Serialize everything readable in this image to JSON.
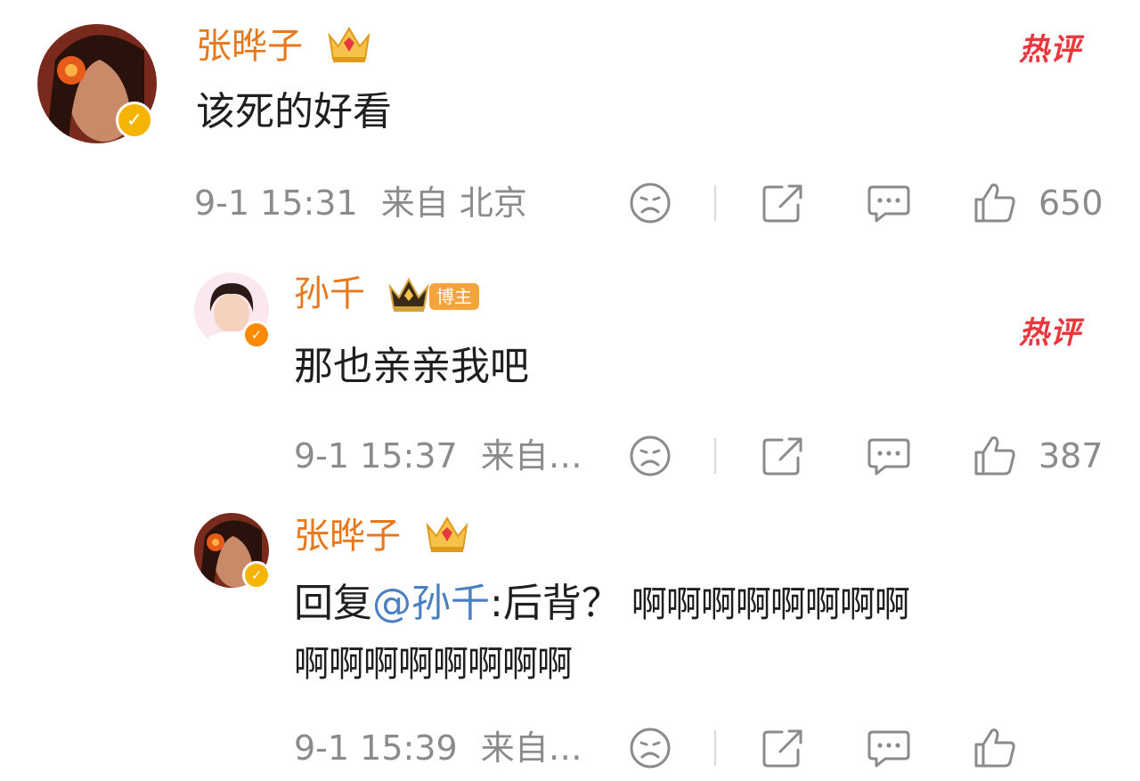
{
  "comments": [
    {
      "username": "张晔子",
      "text": "该死的好看",
      "time": "9-1 15:31",
      "location": "来自 北京",
      "likes": "650",
      "hot_label": "热评"
    },
    {
      "username": "孙千",
      "role_tag": "博主",
      "text": "那也亲亲我吧",
      "time": "9-1 15:37",
      "location": "来自…",
      "likes": "387",
      "hot_label": "热评"
    },
    {
      "username": "张晔子",
      "reply_prefix": "回复",
      "mention": "@孙千",
      "text_after": ":后背？",
      "text_tail": "啊啊啊啊啊啊啊啊",
      "text_line2": "啊啊啊啊啊啊啊啊",
      "time": "9-1 15:39",
      "location": "来自…"
    }
  ],
  "icons": {
    "sad": "sad-face-icon",
    "share": "share-icon",
    "comment": "comment-icon",
    "like": "thumbs-up-icon",
    "crown": "crown-icon",
    "verified": "verified-icon"
  },
  "colors": {
    "username": "#e8781c",
    "mention": "#4a7fc1",
    "hot": "#e8383d",
    "meta": "#8b8b8b"
  }
}
